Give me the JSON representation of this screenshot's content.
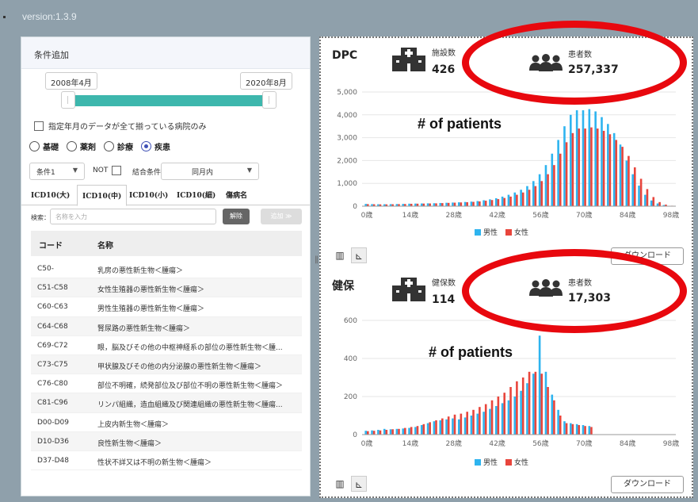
{
  "app": {
    "version": "version:1.3.9"
  },
  "left": {
    "title": "条件追加",
    "date_start": "2008年4月",
    "date_end": "2020年8月",
    "complete_data_only": "指定年月のデータが全て揃っている病院のみ",
    "radios": [
      {
        "label": "基礎",
        "checked": false
      },
      {
        "label": "薬剤",
        "checked": false
      },
      {
        "label": "診療",
        "checked": false
      },
      {
        "label": "疾患",
        "checked": true
      }
    ],
    "condition_select": "条件1",
    "not_label": "NOT",
    "join_label": "結合条件",
    "join_select": "同月内",
    "tabs": [
      "ICD10(大)",
      "ICD10(中)",
      "ICD10(小)",
      "ICD10(細)",
      "傷病名"
    ],
    "active_tab": 1,
    "search_label": "検索：",
    "search_placeholder": "名称を入力",
    "clear_button": "解除",
    "add_button": "追加 ≫",
    "col_code": "コード",
    "col_name": "名称",
    "rows": [
      {
        "code": "C50-",
        "name": "乳房の悪性新生物＜腫瘍＞"
      },
      {
        "code": "C51-C58",
        "name": "女性生殖器の悪性新生物＜腫瘍＞"
      },
      {
        "code": "C60-C63",
        "name": "男性生殖器の悪性新生物＜腫瘍＞"
      },
      {
        "code": "C64-C68",
        "name": "腎尿路の悪性新生物＜腫瘍＞"
      },
      {
        "code": "C69-C72",
        "name": "眼，脳及びその他の中枢神経系の部位の悪性新生物＜腫..."
      },
      {
        "code": "C73-C75",
        "name": "甲状腺及びその他の内分泌腺の悪性新生物＜腫瘍＞"
      },
      {
        "code": "C76-C80",
        "name": "部位不明確，続発部位及び部位不明の悪性新生物＜腫瘍＞"
      },
      {
        "code": "C81-C96",
        "name": "リンパ組織，造血組織及び関連組織の悪性新生物＜腫瘍..."
      },
      {
        "code": "D00-D09",
        "name": "上皮内新生物＜腫瘍＞"
      },
      {
        "code": "D10-D36",
        "name": "良性新生物＜腫瘍＞"
      },
      {
        "code": "D37-D48",
        "name": "性状不詳又は不明の新生物＜腫瘍＞"
      }
    ]
  },
  "dpc": {
    "title": "DPC",
    "facility_label": "施設数",
    "facility_count": "426",
    "patient_label": "患者数",
    "patient_count": "257,337",
    "annotation": "# of patients",
    "download": "ダウンロード"
  },
  "kenpo": {
    "title": "健保",
    "facility_label": "健保数",
    "facility_count": "114",
    "patient_label": "患者数",
    "patient_count": "17,303",
    "annotation": "# of patients",
    "download": "ダウンロード"
  },
  "icons": {
    "hospital": "hospital-icon",
    "people": "people-group-icon",
    "table_view": "table-icon",
    "chart_view": "line-chart-icon"
  },
  "colors": {
    "male": "#2eb4ef",
    "female": "#e8453c",
    "slider": "#3db7ad",
    "highlight": "#e8080e"
  },
  "chart_data": [
    {
      "type": "bar",
      "title": "DPC",
      "x_ticks": [
        "0歳",
        "14歳",
        "28歳",
        "42歳",
        "56歳",
        "70歳",
        "84歳",
        "98歳"
      ],
      "y_ticks": [
        "0",
        "1,000",
        "2,000",
        "3,000",
        "4,000",
        "5,000"
      ],
      "ylim": [
        0,
        5000
      ],
      "x": [
        0,
        2,
        4,
        6,
        8,
        10,
        12,
        14,
        16,
        18,
        20,
        22,
        24,
        26,
        28,
        30,
        32,
        34,
        36,
        38,
        40,
        42,
        44,
        46,
        48,
        50,
        52,
        54,
        56,
        58,
        60,
        62,
        64,
        66,
        68,
        70,
        72,
        74,
        76,
        78,
        80,
        82,
        84,
        86,
        88,
        90,
        92,
        94,
        96,
        98
      ],
      "series": [
        {
          "name": "男性",
          "values": [
            100,
            90,
            85,
            85,
            90,
            95,
            100,
            110,
            115,
            120,
            125,
            130,
            140,
            150,
            160,
            170,
            185,
            200,
            225,
            260,
            300,
            350,
            420,
            500,
            600,
            720,
            880,
            1100,
            1400,
            1800,
            2300,
            2900,
            3500,
            4000,
            4200,
            4200,
            4250,
            4150,
            3900,
            3600,
            3200,
            2700,
            2000,
            1400,
            900,
            500,
            250,
            120,
            50,
            15
          ]
        },
        {
          "name": "女性",
          "values": [
            90,
            85,
            80,
            80,
            85,
            90,
            95,
            105,
            110,
            115,
            120,
            125,
            135,
            145,
            155,
            165,
            175,
            190,
            210,
            240,
            270,
            310,
            360,
            420,
            500,
            600,
            720,
            880,
            1100,
            1400,
            1800,
            2300,
            2800,
            3200,
            3400,
            3400,
            3450,
            3400,
            3300,
            3150,
            2900,
            2600,
            2200,
            1700,
            1200,
            750,
            400,
            180,
            70,
            20
          ]
        }
      ]
    },
    {
      "type": "bar",
      "title": "健保",
      "x_ticks": [
        "0歳",
        "14歳",
        "28歳",
        "42歳",
        "56歳",
        "70歳",
        "84歳",
        "98歳"
      ],
      "y_ticks": [
        "0",
        "200",
        "400",
        "600"
      ],
      "ylim": [
        0,
        600
      ],
      "x": [
        0,
        2,
        4,
        6,
        8,
        10,
        12,
        14,
        16,
        18,
        20,
        22,
        24,
        26,
        28,
        30,
        32,
        34,
        36,
        38,
        40,
        42,
        44,
        46,
        48,
        50,
        52,
        54,
        56,
        58,
        60,
        62,
        64,
        66,
        68,
        70,
        72,
        74,
        76,
        78,
        80,
        82,
        84,
        86,
        88,
        90,
        92,
        94,
        96,
        98
      ],
      "series": [
        {
          "name": "男性",
          "values": [
            20,
            22,
            25,
            30,
            28,
            30,
            32,
            35,
            40,
            50,
            60,
            70,
            75,
            80,
            85,
            80,
            90,
            100,
            110,
            120,
            135,
            150,
            165,
            180,
            200,
            230,
            270,
            320,
            520,
            330,
            210,
            130,
            70,
            60,
            55,
            50,
            45,
            0,
            0,
            0,
            0,
            0,
            0,
            0,
            0,
            0,
            0,
            0,
            0,
            0
          ]
        },
        {
          "name": "女性",
          "values": [
            18,
            20,
            22,
            25,
            28,
            30,
            35,
            40,
            45,
            55,
            65,
            75,
            85,
            95,
            105,
            110,
            120,
            130,
            145,
            160,
            180,
            200,
            220,
            250,
            280,
            300,
            330,
            330,
            320,
            250,
            180,
            100,
            60,
            55,
            50,
            45,
            40,
            0,
            0,
            0,
            0,
            0,
            0,
            0,
            0,
            0,
            0,
            0,
            0,
            0
          ]
        }
      ],
      "legend": [
        "男性",
        "女性"
      ]
    }
  ]
}
